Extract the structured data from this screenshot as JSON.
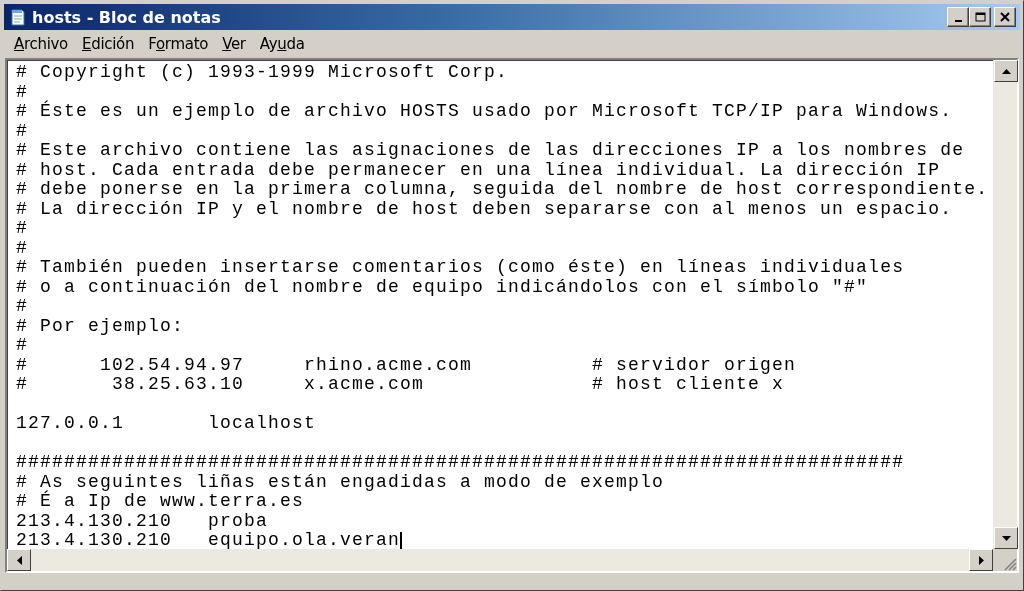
{
  "window": {
    "title": "hosts - Bloc de notas"
  },
  "menu": [
    {
      "key": "A",
      "after": "rchivo"
    },
    {
      "key": "E",
      "after": "dición"
    },
    {
      "before": "F",
      "key": "o",
      "after": "rmato"
    },
    {
      "key": "V",
      "after": "er"
    },
    {
      "before": "Ay",
      "key": "u",
      "after": "da"
    }
  ],
  "editor": {
    "lines": [
      {
        "kind": "text",
        "text": "# Copyright (c) 1993-1999 Microsoft Corp.",
        "caret": false
      },
      {
        "kind": "text",
        "text": "#",
        "caret": false
      },
      {
        "kind": "text",
        "text": "# Éste es un ejemplo de archivo HOSTS usado por Microsoft TCP/IP para Windows.",
        "caret": false
      },
      {
        "kind": "text",
        "text": "#",
        "caret": false
      },
      {
        "kind": "text",
        "text": "# Este archivo contiene las asignaciones de las direcciones IP a los nombres de",
        "caret": false
      },
      {
        "kind": "text",
        "text": "# host. Cada entrada debe permanecer en una línea individual. La dirección IP",
        "caret": false
      },
      {
        "kind": "text",
        "text": "# debe ponerse en la primera columna, seguida del nombre de host correspondiente.",
        "caret": false
      },
      {
        "kind": "text",
        "text": "# La dirección IP y el nombre de host deben separarse con al menos un espacio.",
        "caret": false
      },
      {
        "kind": "text",
        "text": "#",
        "caret": false
      },
      {
        "kind": "text",
        "text": "#",
        "caret": false
      },
      {
        "kind": "text",
        "text": "# También pueden insertarse comentarios (como éste) en líneas individuales",
        "caret": false
      },
      {
        "kind": "text",
        "text": "# o a continuación del nombre de equipo indicándolos con el símbolo \"#\"",
        "caret": false
      },
      {
        "kind": "text",
        "text": "#",
        "caret": false
      },
      {
        "kind": "text",
        "text": "# Por ejemplo:",
        "caret": false
      },
      {
        "kind": "text",
        "text": "#",
        "caret": false
      },
      {
        "kind": "text",
        "text": "#      102.54.94.97     rhino.acme.com          # servidor origen",
        "caret": false
      },
      {
        "kind": "text",
        "text": "#       38.25.63.10     x.acme.com              # host cliente x",
        "caret": false
      },
      {
        "kind": "blank",
        "caret": false
      },
      {
        "kind": "text",
        "text": "127.0.0.1       localhost",
        "caret": false
      },
      {
        "kind": "blank",
        "caret": false
      },
      {
        "kind": "text",
        "text": "##########################################################################",
        "caret": false
      },
      {
        "kind": "text",
        "text": "# As seguintes liñas están engadidas a modo de exemplo",
        "caret": false
      },
      {
        "kind": "text",
        "text": "# É a Ip de www.terra.es",
        "caret": false
      },
      {
        "kind": "text",
        "text": "213.4.130.210   proba",
        "caret": false
      },
      {
        "kind": "text",
        "text": "213.4.130.210   equipo.ola.veran",
        "caret": true
      }
    ]
  }
}
